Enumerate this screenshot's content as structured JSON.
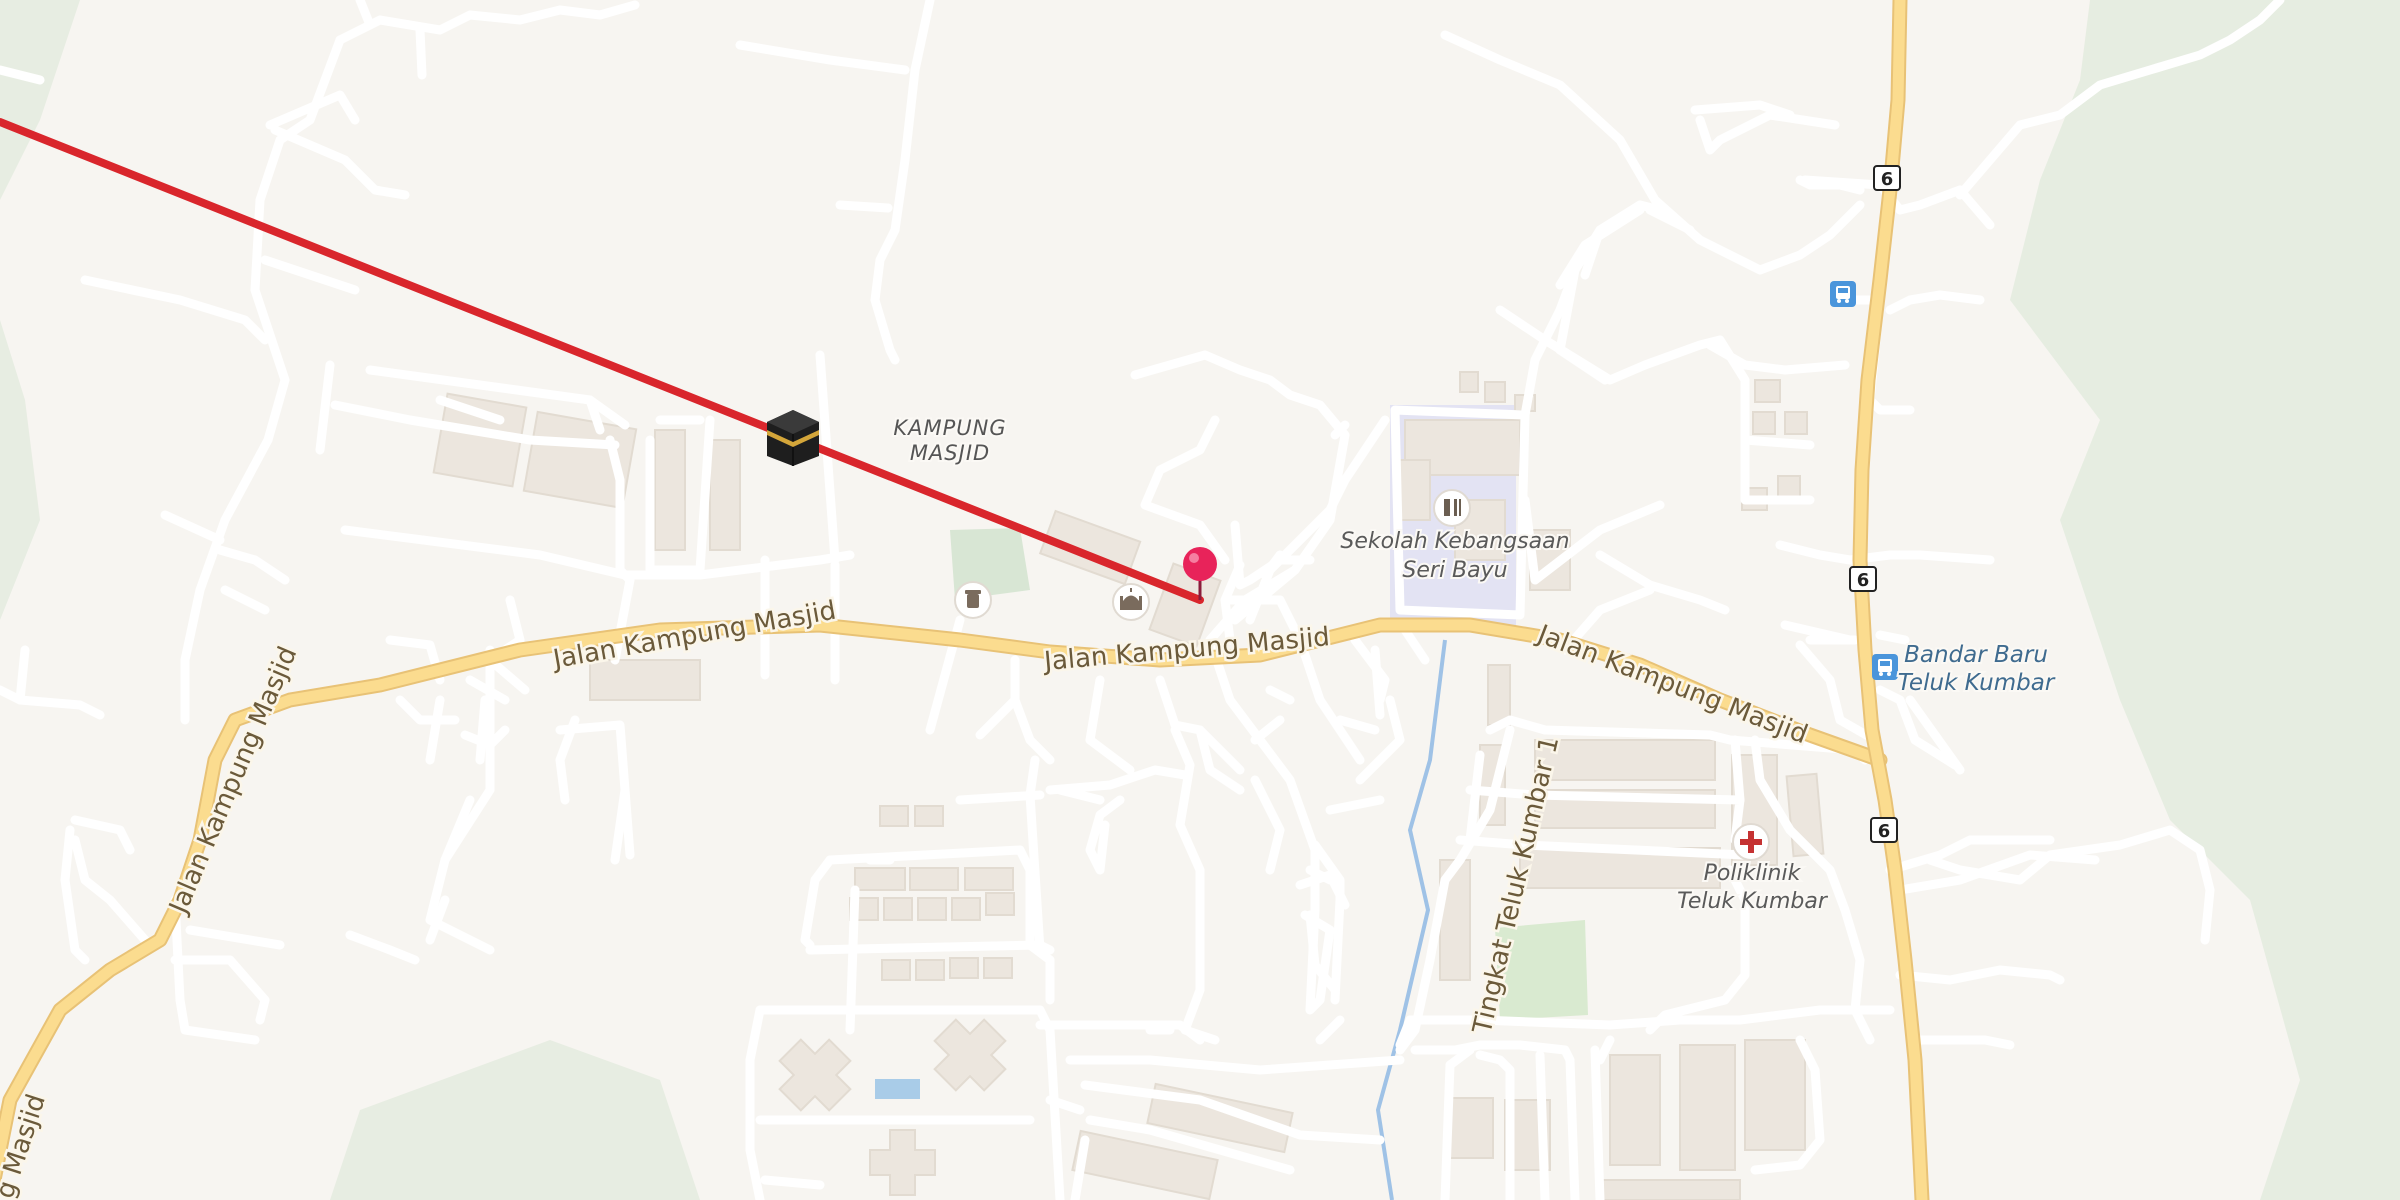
{
  "map": {
    "roads": {
      "main_road_name": "Jalan Kampung Masjid",
      "main_road_name_edge": "g Masjid",
      "side_road_name": "Tingkat Teluk Kumbar 1"
    },
    "places": {
      "village_line1": "KAMPUNG",
      "village_line2": "MASJID"
    },
    "pois": {
      "school_line1": "Sekolah Kebangsaan",
      "school_line2": "Seri Bayu",
      "clinic_line1": "Poliklinik",
      "clinic_line2": "Teluk Kumbar",
      "bus_stop_line1": "Bandar Baru",
      "bus_stop_line2": "Teluk Kumbar"
    },
    "route_shields": [
      "6",
      "6",
      "6"
    ],
    "icons": {
      "kaaba": "kaaba-icon",
      "pin": "location-pin-icon",
      "mosque": "mosque-icon",
      "cemetery": "cemetery-icon",
      "school": "school-icon",
      "clinic": "clinic-icon",
      "bus": "bus-stop-icon"
    },
    "colors": {
      "background": "#f7f5f1",
      "qibla_line": "#d9262c",
      "pin": "#e8235a",
      "main_road": "#fbdc8f",
      "water": "#9fc2e6",
      "park": "#d9ead0"
    }
  }
}
